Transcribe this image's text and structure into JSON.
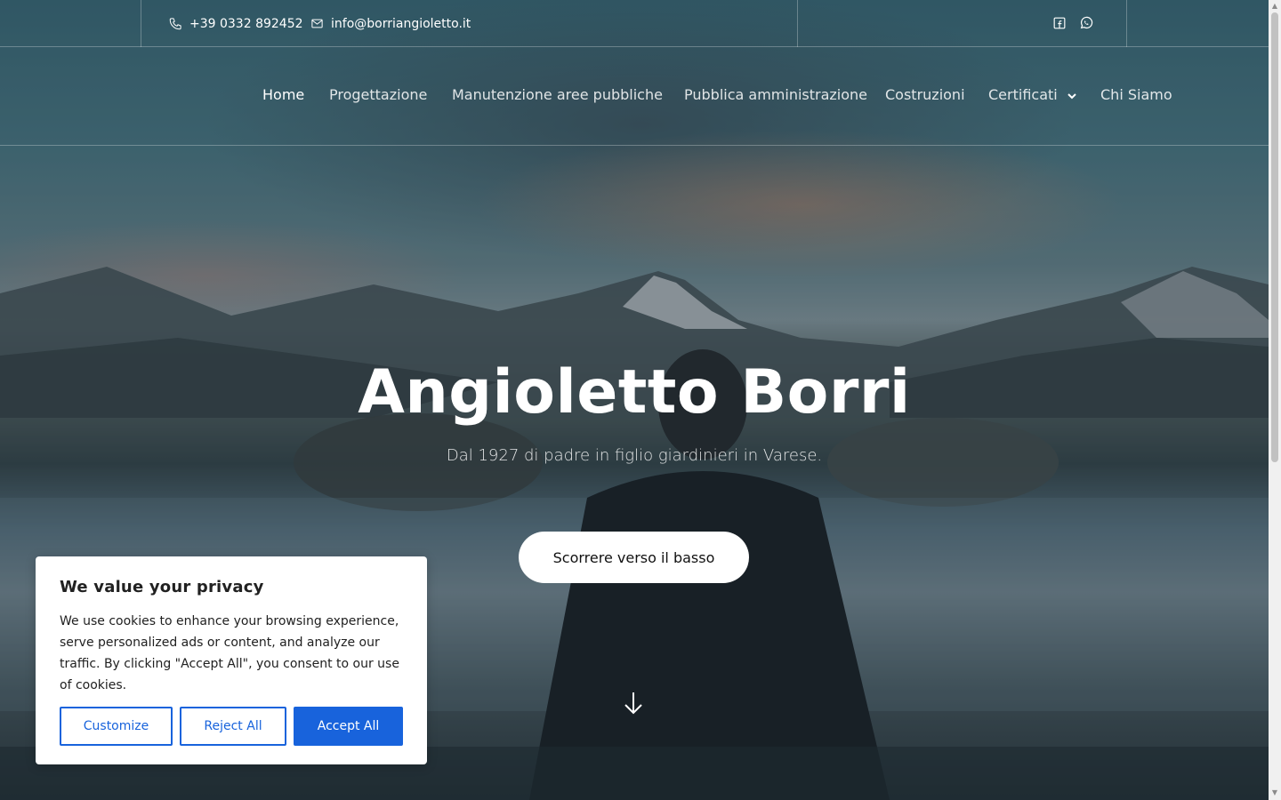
{
  "topbar": {
    "phone": "+39 0332 892452",
    "email": "info@borriangioletto.it",
    "icons": [
      "phone-icon",
      "mail-icon",
      "facebook-icon",
      "whatsapp-icon"
    ]
  },
  "nav": {
    "items": [
      {
        "label": "Home",
        "active": true
      },
      {
        "label": "Progettazione"
      },
      {
        "label": "Manutenzione aree pubbliche"
      },
      {
        "label": "Pubblica amministrazione"
      },
      {
        "label": "Costruzioni"
      },
      {
        "label": "Certificati",
        "has_dropdown": true
      },
      {
        "label": "Chi Siamo"
      }
    ]
  },
  "hero": {
    "title": "Angioletto Borri",
    "subtitle": "Dal 1927 di padre in figlio giardinieri in Varese.",
    "cta_label": "Scorrere verso il basso"
  },
  "cookie": {
    "title": "We value your privacy",
    "body": "We use cookies to enhance your browsing experience, serve personalized ads or content, and analyze our traffic. By clicking \"Accept All\", you consent to our use of cookies.",
    "customize_label": "Customize",
    "reject_label": "Reject All",
    "accept_label": "Accept All"
  },
  "colors": {
    "accent": "#1863dc",
    "text_dark": "#212121",
    "white": "#ffffff"
  }
}
